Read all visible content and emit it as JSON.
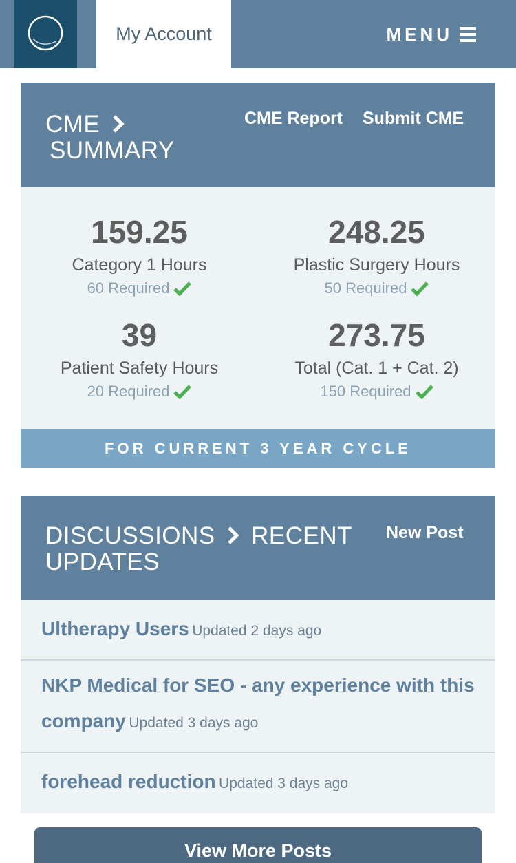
{
  "topbar": {
    "account_tab": "My Account",
    "menu_label": "MENU"
  },
  "cme": {
    "title_line1": "CME",
    "title_line2": "SUMMARY",
    "report_link": "CME Report",
    "submit_link": "Submit CME",
    "stats": [
      {
        "value": "159.25",
        "label": "Category 1 Hours",
        "required": "60 Required"
      },
      {
        "value": "248.25",
        "label": "Plastic Surgery Hours",
        "required": "50 Required"
      },
      {
        "value": "39",
        "label": "Patient Safety Hours",
        "required": "20 Required"
      },
      {
        "value": "273.75",
        "label": "Total (Cat. 1 + Cat. 2)",
        "required": "150 Required"
      }
    ],
    "cycle_label": "FOR CURRENT 3 YEAR CYCLE"
  },
  "discussions": {
    "title_part1": "DISCUSSIONS",
    "title_part2": "RECENT",
    "title_line2": "UPDATES",
    "new_post_link": "New Post",
    "items": [
      {
        "title": "Ultherapy Users",
        "updated": "Updated 2 days ago"
      },
      {
        "title": "NKP Medical for SEO - any experience with this company",
        "updated": "Updated 3 days ago"
      },
      {
        "title": "forehead reduction",
        "updated": "Updated 3 days ago"
      }
    ],
    "view_more": "View More Posts"
  },
  "colors": {
    "header_blue": "#5f819e",
    "logo_navy": "#1b4f6b",
    "panel_bg": "#eef3f6",
    "cycle_bar": "#7aa6c6",
    "check_green": "#4caf50",
    "button_dark": "#4e6a82"
  }
}
